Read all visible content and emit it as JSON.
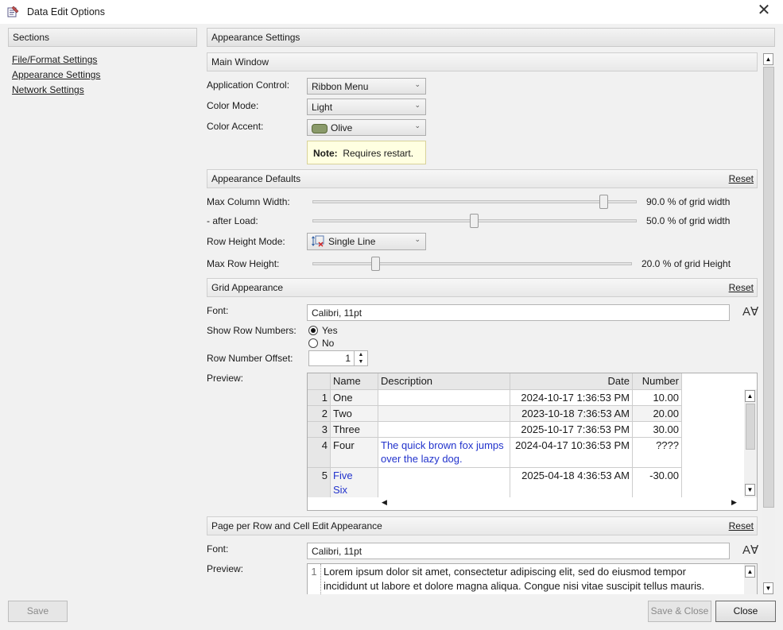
{
  "window": {
    "title": "Data Edit Options",
    "close_glyph": "✕"
  },
  "sidebar": {
    "header": "Sections",
    "items": [
      {
        "label": "File/Format Settings"
      },
      {
        "label": "Appearance Settings"
      },
      {
        "label": "Network Settings"
      }
    ]
  },
  "main": {
    "header": "Appearance Settings",
    "main_window": {
      "header": "Main Window",
      "application_control": {
        "label": "Application Control:",
        "value": "Ribbon Menu"
      },
      "color_mode": {
        "label": "Color Mode:",
        "value": "Light"
      },
      "color_accent": {
        "label": "Color Accent:",
        "value": "Olive",
        "swatch_color": "#8a9a6a"
      },
      "note": {
        "bold": "Note:",
        "text": "Requires restart."
      }
    },
    "appearance_defaults": {
      "header": "Appearance Defaults",
      "reset": "Reset",
      "max_column_width": {
        "label": "Max Column Width:",
        "value_text": "90.0 % of grid width",
        "level": 0.9
      },
      "after_load": {
        "label": "- after Load:",
        "value_text": "50.0 % of grid width",
        "level": 0.5
      },
      "row_height_mode": {
        "label": "Row Height Mode:",
        "value": "Single Line"
      },
      "max_row_height": {
        "label": "Max Row Height:",
        "value_text": "20.0 % of grid Height",
        "level": 0.2
      }
    },
    "grid_appearance": {
      "header": "Grid Appearance",
      "reset": "Reset",
      "font": {
        "label": "Font:",
        "value": "Calibri, 11pt"
      },
      "show_row_numbers": {
        "label": "Show Row Numbers:",
        "yes": "Yes",
        "no": "No",
        "selected": "Yes"
      },
      "row_number_offset": {
        "label": "Row Number Offset:",
        "value": "1"
      },
      "preview_label": "Preview:",
      "preview": {
        "columns": [
          "Name",
          "Description",
          "Date",
          "Number"
        ],
        "rows": [
          {
            "num": "1",
            "name": "One",
            "description": "",
            "date": "2024-10-17 1:36:53 PM",
            "number": "10.00"
          },
          {
            "num": "2",
            "name": "Two",
            "description": "",
            "date": "2023-10-18 7:36:53 AM",
            "number": "20.00"
          },
          {
            "num": "3",
            "name": "Three",
            "description": "",
            "date": "2025-10-17 7:36:53 PM",
            "number": "30.00"
          },
          {
            "num": "4",
            "name": "Four",
            "description_line1": "The quick brown fox jumps",
            "description_line2": "over the lazy dog.",
            "date": "2024-04-17 10:36:53 PM",
            "number": "????"
          },
          {
            "num": "5",
            "name_line1": "Five",
            "name_line2": "Six",
            "description": "",
            "date": "2025-04-18 4:36:53 AM",
            "number": "-30.00"
          }
        ]
      }
    },
    "page_per_row": {
      "header": "Page per Row and Cell Edit Appearance",
      "reset": "Reset",
      "font": {
        "label": "Font:",
        "value": "Calibri, 11pt"
      },
      "preview_label": "Preview:",
      "preview_line_num": "1",
      "preview_line1": "Lorem ipsum dolor sit amet, consectetur adipiscing elit, sed do eiusmod tempor",
      "preview_line2": "incididunt ut labore et dolore magna aliqua. Congue nisi vitae suscipit tellus mauris."
    }
  },
  "footer": {
    "save": "Save",
    "save_close": "Save & Close",
    "close": "Close"
  },
  "colors": {
    "link_blue": "#2233cc",
    "note_bg": "#ffffe1"
  }
}
